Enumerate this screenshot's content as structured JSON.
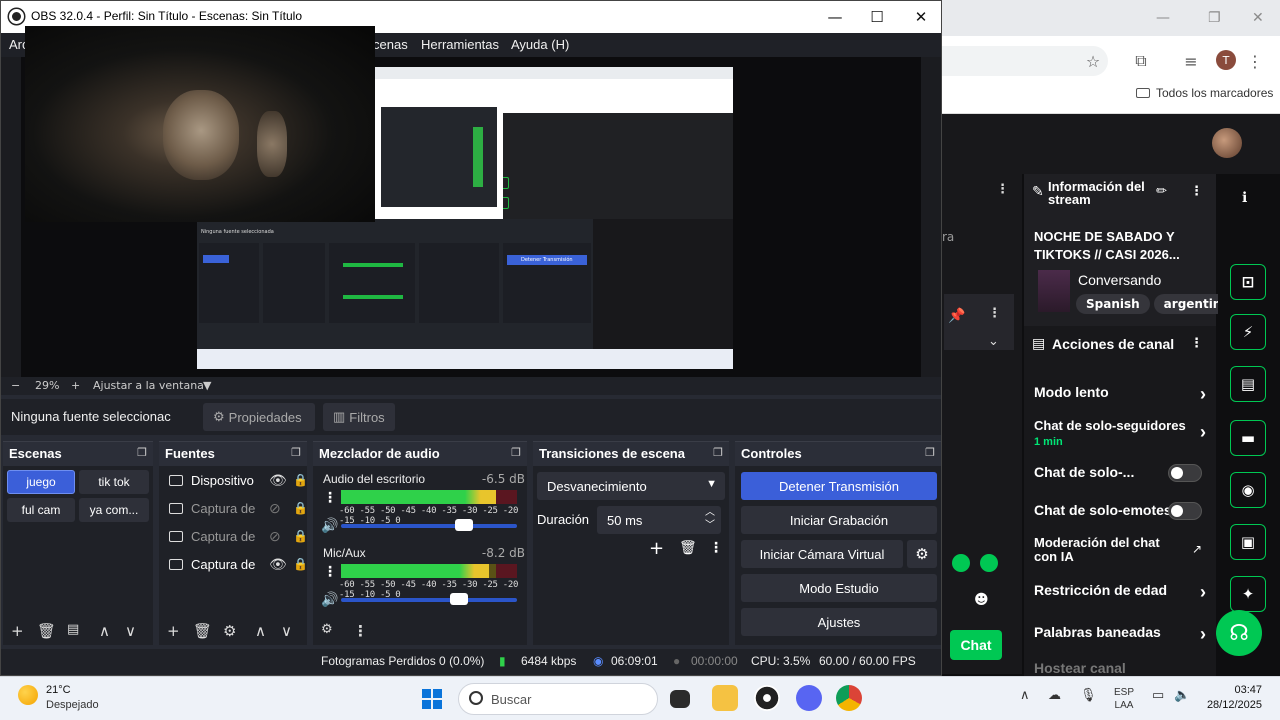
{
  "browser": {
    "bookmarks_label": "Todos los marcadores",
    "profile_initial": "T",
    "stream_info": {
      "header": "Información del stream",
      "title": "NOCHE DE SABADO Y TIKTOKS // CASI 2026...",
      "category": "Conversando",
      "tags": [
        "Spanish",
        "argentina"
      ]
    },
    "channel_actions": {
      "header": "Acciones de canal",
      "items": [
        {
          "label": "Modo lento",
          "kind": "arrow"
        },
        {
          "label": "Chat de solo-seguidores",
          "sub": "1 min",
          "kind": "arrow"
        },
        {
          "label": "Chat de solo-...",
          "kind": "toggle"
        },
        {
          "label": "Chat de solo-emotes",
          "kind": "toggle"
        },
        {
          "label": "Moderación del chat con IA",
          "kind": "external"
        },
        {
          "label": "Restricción de edad",
          "kind": "arrow"
        },
        {
          "label": "Palabras baneadas",
          "kind": "arrow"
        },
        {
          "label": "Hostear canal",
          "kind": "none"
        }
      ]
    },
    "left_partial_text": "ra",
    "chat_button": "Chat"
  },
  "obs": {
    "title": "OBS 32.0.4 - Perfil: Sin Título - Escenas: Sin Título",
    "menu": [
      "Arc",
      "cenas",
      "Herramientas",
      "Ayuda (H)"
    ],
    "zoom": {
      "value": "29%",
      "fit_label": "Ajustar a la ventana"
    },
    "source_bar": {
      "none_selected": "Ninguna fuente seleccionac",
      "properties": "Propiedades",
      "filters": "Filtros"
    },
    "scenes": {
      "title": "Escenas",
      "items": [
        "juego",
        "tik tok",
        "ful cam",
        "ya com..."
      ],
      "active": "juego"
    },
    "sources": {
      "title": "Fuentes",
      "items": [
        {
          "name": "Dispositivo",
          "visible": true
        },
        {
          "name": "Captura de",
          "visible": false
        },
        {
          "name": "Captura de",
          "visible": false
        },
        {
          "name": "Captura de",
          "visible": true
        }
      ]
    },
    "mixer": {
      "title": "Mezclador de audio",
      "channels": [
        {
          "name": "Audio del escritorio",
          "db": "-6.5 dB",
          "level": 0.88,
          "volume": 0.7
        },
        {
          "name": "Mic/Aux",
          "db": "-8.2 dB",
          "level": 0.84,
          "volume": 0.67
        }
      ],
      "scale": "-60 -55 -50 -45 -40 -35 -30 -25 -20 -15 -10 -5 0"
    },
    "transitions": {
      "title": "Transiciones de escena",
      "selected": "Desvanecimiento",
      "duration_label": "Duración",
      "duration_value": "50 ms"
    },
    "controls": {
      "title": "Controles",
      "stop_stream": "Detener Transmisión",
      "start_recording": "Iniciar Grabación",
      "start_virtual_cam": "Iniciar Cámara Virtual",
      "studio_mode": "Modo Estudio",
      "settings": "Ajustes"
    },
    "status": {
      "dropped_frames": "Fotogramas Perdidos 0 (0.0%)",
      "bitrate": "6484 kbps",
      "stream_time": "06:09:01",
      "rec_time": "00:00:00",
      "cpu": "CPU: 3.5%",
      "fps": "60.00 / 60.00 FPS"
    }
  },
  "taskbar": {
    "weather_temp": "21°C",
    "weather_desc": "Despejado",
    "search_placeholder": "Buscar",
    "language": "ESP",
    "region": "LAA",
    "time": "03:47",
    "date": "28/12/2025"
  },
  "colors": {
    "accent_blue": "#3b5fd9",
    "twitch_green": "#00c853",
    "obs_bg": "#1f2127"
  }
}
